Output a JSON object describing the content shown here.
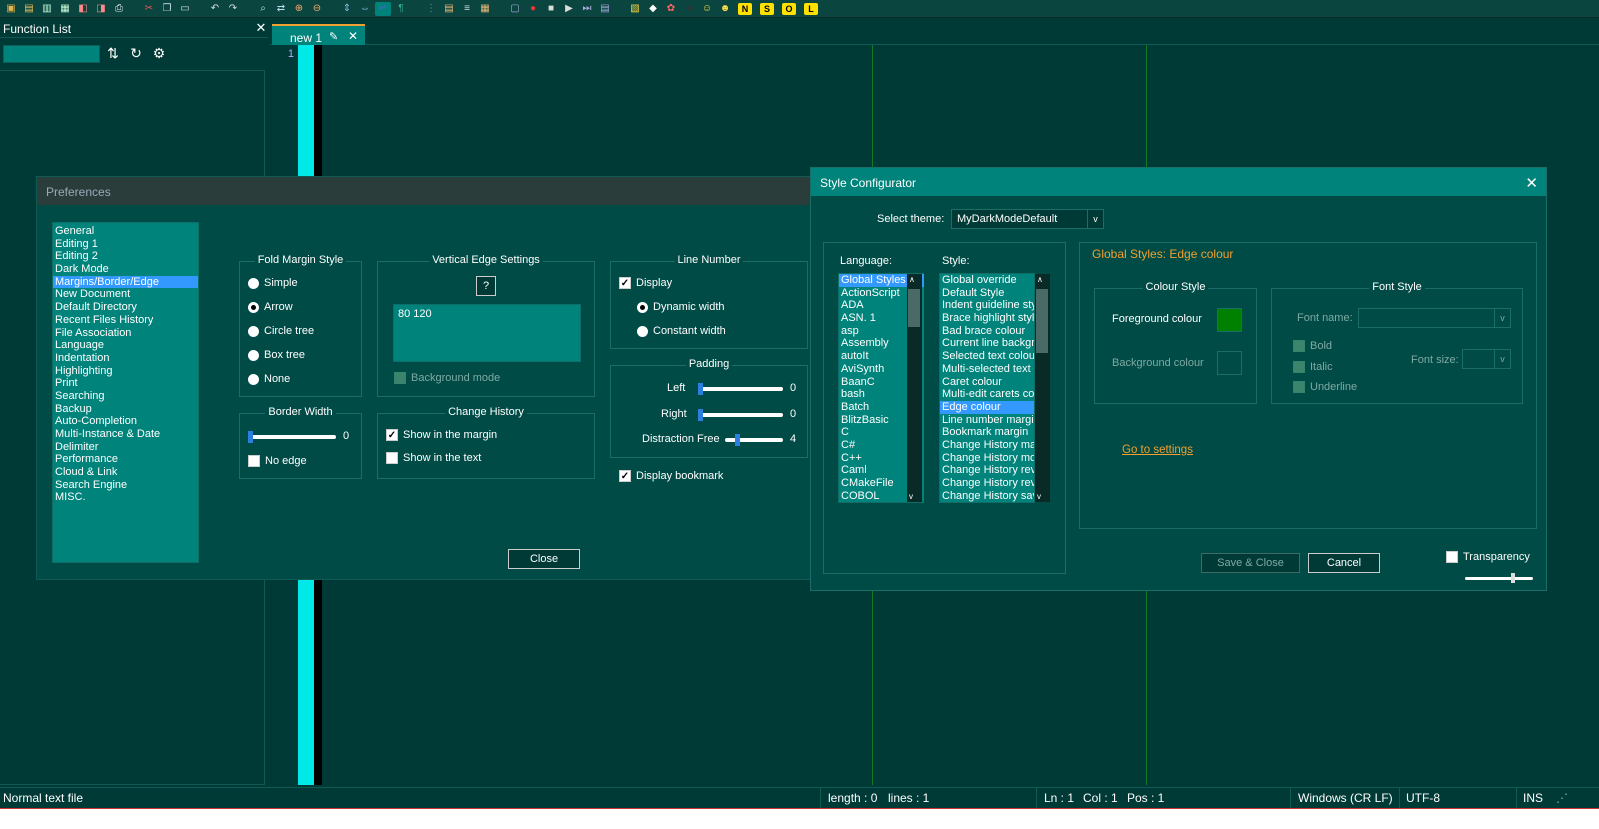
{
  "toolbar": {
    "icons": [
      "new-file-icon",
      "open-file-icon",
      "save-icon",
      "save-all-icon",
      "close-icon",
      "close-all-icon",
      "print-icon",
      "cut-icon",
      "copy-icon",
      "paste-icon",
      "undo-icon",
      "redo-icon",
      "find-icon",
      "replace-icon",
      "zoom-in-icon",
      "zoom-out-icon",
      "sync-vertical-icon",
      "sync-horizontal-icon",
      "word-wrap-icon",
      "show-all-chars-icon",
      "indent-guide-icon",
      "doc-map-icon",
      "function-list-icon",
      "folder-workspace-icon",
      "monitor-icon",
      "record-macro-icon",
      "stop-macro-icon",
      "play-macro-icon",
      "play-multi-icon",
      "save-macro-icon",
      "plugin-1-icon",
      "plugin-2-icon",
      "plugin-3-icon",
      "plugin-4-icon",
      "plugin-5-icon",
      "plugin-6-icon",
      "letter-n-icon",
      "letter-s-icon",
      "letter-o-icon",
      "letter-l-icon"
    ],
    "letters": [
      "N",
      "S",
      "O",
      "L"
    ]
  },
  "function_list": {
    "title": "Function List"
  },
  "tab": {
    "label": "new 1"
  },
  "gutter": {
    "line": "1"
  },
  "status": {
    "type": "Normal text file",
    "length": "length : 0",
    "lines": "lines : 1",
    "ln": "Ln : 1",
    "col": "Col : 1",
    "pos": "Pos : 1",
    "eol": "Windows (CR LF)",
    "encoding": "UTF-8",
    "mode": "INS"
  },
  "prefs": {
    "title": "Preferences",
    "categories": [
      "General",
      "Editing 1",
      "Editing 2",
      "Dark Mode",
      "Margins/Border/Edge",
      "New Document",
      "Default Directory",
      "Recent Files History",
      "File Association",
      "Language",
      "Indentation",
      "Highlighting",
      "Print",
      "Searching",
      "Backup",
      "Auto-Completion",
      "Multi-Instance & Date",
      "Delimiter",
      "Performance",
      "Cloud & Link",
      "Search Engine",
      "MISC."
    ],
    "selected_index": 4,
    "fold_margin": {
      "title": "Fold Margin Style",
      "options": [
        "Simple",
        "Arrow",
        "Circle tree",
        "Box tree",
        "None"
      ],
      "selected": "Arrow"
    },
    "vertical_edge": {
      "title": "Vertical Edge Settings",
      "help": "?",
      "value": "80 120",
      "background_mode": "Background mode"
    },
    "line_number": {
      "title": "Line Number",
      "display": "Display",
      "dynamic": "Dynamic width",
      "constant": "Constant width",
      "selected": "Dynamic width",
      "display_checked": true
    },
    "padding": {
      "title": "Padding",
      "left_label": "Left",
      "left_value": "0",
      "right_label": "Right",
      "right_value": "0",
      "distraction_label": "Distraction Free",
      "distraction_value": "4"
    },
    "border_width": {
      "title": "Border Width",
      "value": "0",
      "no_edge": "No edge"
    },
    "change_history": {
      "title": "Change History",
      "margin": "Show in the margin",
      "text": "Show in the text",
      "margin_checked": true
    },
    "display_bookmark": "Display bookmark",
    "close": "Close"
  },
  "style": {
    "title": "Style Configurator",
    "theme_label": "Select theme:",
    "theme_value": "MyDarkModeDefault",
    "language_label": "Language:",
    "style_label": "Style:",
    "languages": [
      "Global Styles",
      "ActionScript",
      "ADA",
      "ASN. 1",
      "asp",
      "Assembly",
      "autoIt",
      "AviSynth",
      "BaanC",
      "bash",
      "Batch",
      "BlitzBasic",
      "C",
      "C#",
      "C++",
      "Caml",
      "CMakeFile",
      "COBOL"
    ],
    "styles": [
      "Global override",
      "Default Style",
      "Indent guideline sty",
      "Brace highlight style",
      "Bad brace colour",
      "Current line backgr",
      "Selected text colour",
      "Multi-selected text c",
      "Caret colour",
      "Multi-edit carets col",
      "Edge colour",
      "Line number margin",
      "Bookmark margin",
      "Change History mar",
      "Change History mod",
      "Change History rev",
      "Change History rev",
      "Change History sav"
    ],
    "selected_style_index": 10,
    "heading": "Global Styles: Edge colour",
    "colour_style": "Colour Style",
    "fg": "Foreground colour",
    "bg": "Background colour",
    "fg_color": "#008000",
    "font_style": "Font Style",
    "font_name": "Font name:",
    "font_size": "Font size:",
    "bold": "Bold",
    "italic": "Italic",
    "underline": "Underline",
    "go": "Go to settings",
    "save": "Save & Close",
    "cancel": "Cancel",
    "transparency": "Transparency"
  },
  "colors": {
    "accent_orange": "#f0a030",
    "selection": "#3399ff",
    "teal": "#00837a",
    "fold_cyan": "#00e8e8",
    "edge_green": "#0e7a2a"
  }
}
